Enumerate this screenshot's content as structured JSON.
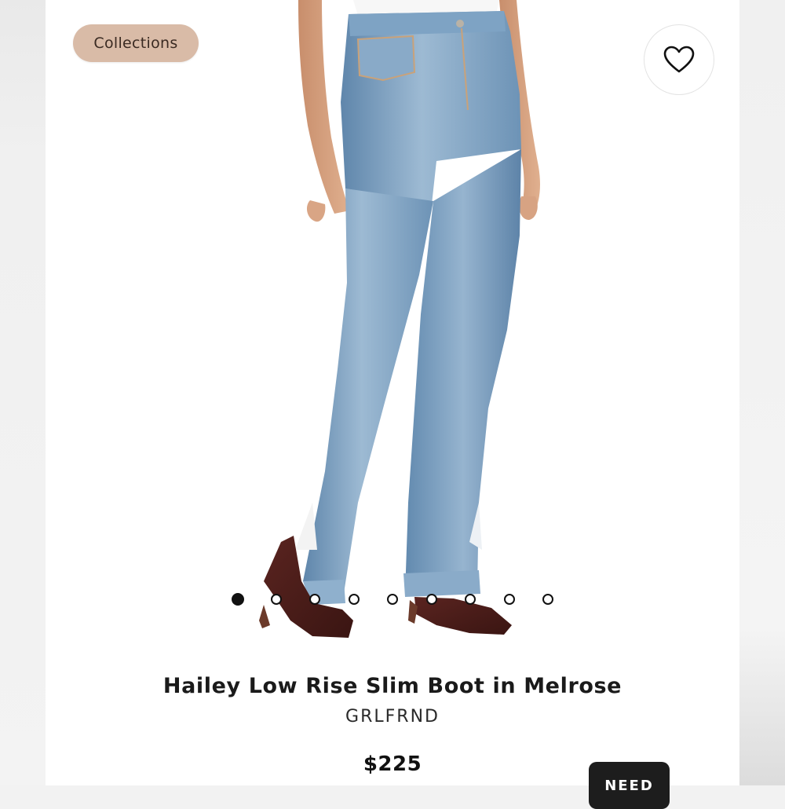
{
  "collections_label": "Collections",
  "favorite_icon": "heart-outline-icon",
  "carousel": {
    "total": 9,
    "active_index": 0
  },
  "product": {
    "name": "Hailey Low Rise Slim Boot in Melrose",
    "brand": "GRLFRND",
    "price": "$225"
  },
  "help_button_label": "NEED",
  "colors": {
    "chip_bg": "#d9bba7",
    "denim": "#6f95b8",
    "boot": "#4a1c18",
    "button_dark": "#1d1d1d"
  }
}
